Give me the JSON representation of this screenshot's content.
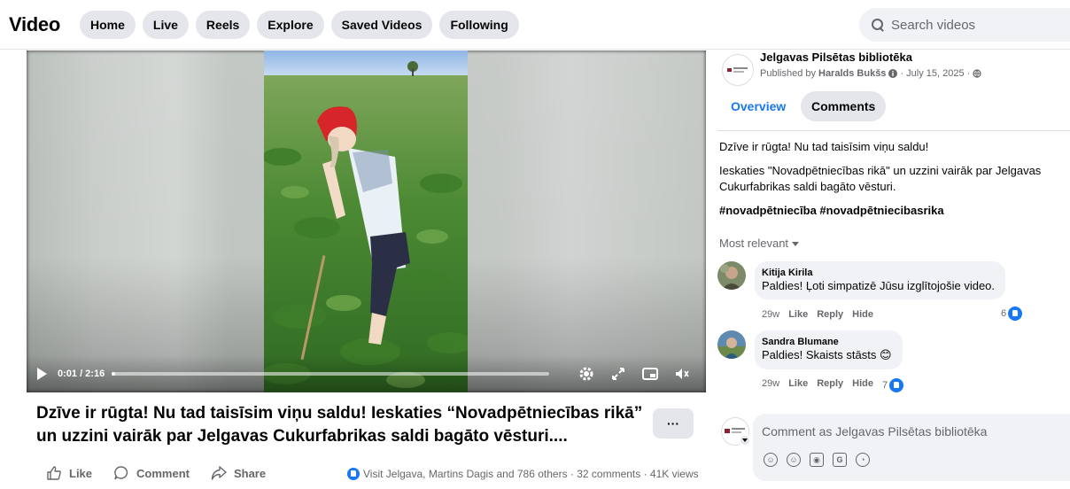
{
  "header": {
    "brand": "Video",
    "nav": [
      "Home",
      "Live",
      "Reels",
      "Explore",
      "Saved Videos",
      "Following"
    ],
    "search_placeholder": "Search videos"
  },
  "player": {
    "time": "0:01 / 2:16",
    "progress_fraction": 0.007
  },
  "video": {
    "title": "Dzīve ir rūgta! Nu tad taisīsim viņu saldu! Ieskaties “Novadpētniecības rikā” un uzzini vairāk par Jelgavas Cukurfabrikas saldi bagāto vēsturi....",
    "more_label": "···",
    "actions": {
      "like": "Like",
      "comment": "Comment",
      "share": "Share"
    },
    "stats": "Visit Jelgava, Martins Dagis and 786 others · 32 comments · 41K views"
  },
  "page": {
    "name": "Jelgavas Pilsētas bibliotēka",
    "published_prefix": "Published by",
    "published_by": "Haralds Bukšs",
    "published_date": "· July 15, 2025 ·"
  },
  "tabs": {
    "overview": "Overview",
    "comments": "Comments"
  },
  "description": {
    "line1": "Dzīve ir rūgta! Nu tad taisīsim viņu saldu!",
    "line2": "Ieskaties \"Novadpētniecības rikā\" un uzzini vairāk par Jelgavas",
    "line3": "Cukurfabrikas saldi bagāto vēsturi.",
    "hashtags": "#novadpētniecība #novadpētniecibasrika"
  },
  "sort_label": "Most relevant",
  "comments": [
    {
      "name": "Kitija Kirila",
      "text": "Paldies! Ļoti simpatizē Jūsu izglītojošie video.",
      "age": "29w",
      "like": "Like",
      "reply": "Reply",
      "hide": "Hide",
      "count": "6"
    },
    {
      "name": "Sandra Blumane",
      "text": "Paldies! Skaists stāsts 😊",
      "age": "29w",
      "like": "Like",
      "reply": "Reply",
      "hide": "Hide",
      "count": "7"
    }
  ],
  "composer": {
    "placeholder": "Comment as Jelgavas Pilsētas bibliotēka"
  },
  "colors": {
    "accent": "#1877f2",
    "pill_bg": "#e4e6eb",
    "secondary_text": "#65676b"
  }
}
